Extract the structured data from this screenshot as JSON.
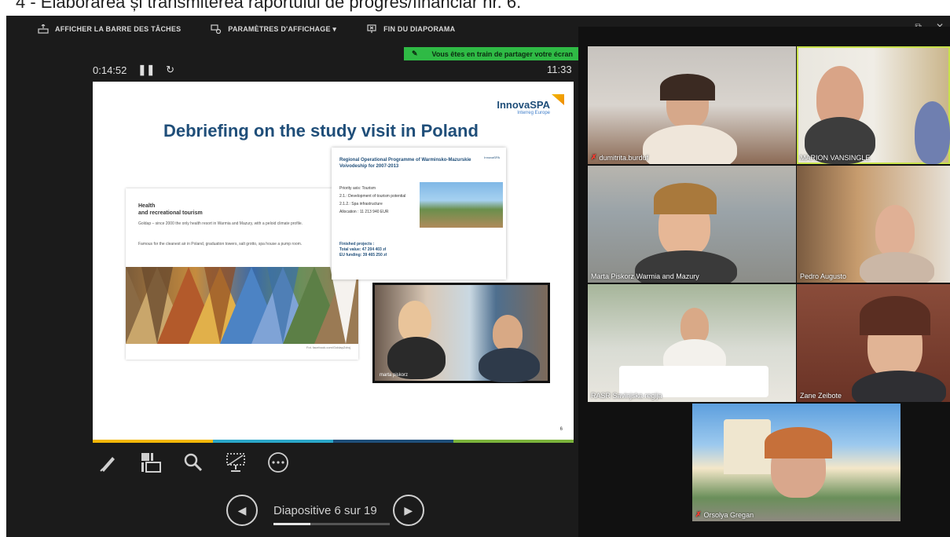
{
  "doc_caption": "4 - Elaborarea și transmiterea raportului de progres/financiar nr. 6.",
  "toolbar": {
    "taskbar_label": "AFFICHER LA BARRE DES TÂCHES",
    "display_settings_label": "PARAMÈTRES D'AFFICHAGE ▾",
    "end_slideshow_label": "FIN DU DIAPORAMA"
  },
  "window": {
    "minimize": "–",
    "restore": "⧉",
    "close": "✕"
  },
  "share_banner": "Vous êtes en train de partager votre écran",
  "timer": "0:14:52",
  "clock": "11:33",
  "slide": {
    "title": "Debriefing on the study visit in Poland",
    "logo_name": "InnovaSPA",
    "logo_sub": "Interreg Europe",
    "left_card": {
      "heading_1": "Health",
      "heading_2": "and recreational tourism",
      "para_1": "Goldap – since 2000 the only health resort in Warmia and Mazury, with a peloid climate profile.",
      "para_2": "Famous for the cleanest air in Poland, graduation towers, salt grotto, spa house a pump room.",
      "photo_credit": "Fot. facebook.com/GoldapZdroj"
    },
    "right_card": {
      "heading": "Regional Operational Programme of Warminsko-Mazurskie Voivodeship for 2007-2013",
      "bullets": [
        "Priority axis: Tourism",
        "2.1.: Development of tourism potential",
        "2.1.2.: Spa infrastructure",
        "Allocation : 11 213 940 EUR"
      ],
      "finished_title": "Finished projects :",
      "finished_items": [
        "Total value: 47 204 403 zł",
        "EU funding: 39 465 250 zł"
      ]
    },
    "video_inset_label": "marta piskorz",
    "page_number": "6"
  },
  "tools": {
    "pen": "pen-icon",
    "grid": "slides-grid-icon",
    "zoom": "zoom-icon",
    "pointer": "screen-pointer-icon",
    "more": "more-options-icon"
  },
  "navigation": {
    "prev": "◀",
    "next": "▶",
    "label": "Diapositive 6 sur 19",
    "progress": 0.316
  },
  "participants": [
    {
      "name": "dumitrita.burduf",
      "muted": true
    },
    {
      "name": "MARION VANSINGLE",
      "muted": false,
      "active": true
    },
    {
      "name": "Marta Piskorz Warmia and Mazury",
      "muted": false
    },
    {
      "name": "Pedro Augusto",
      "muted": false
    },
    {
      "name": "RASR Savinjska regija",
      "muted": false
    },
    {
      "name": "Zane Zeibote",
      "muted": false
    },
    {
      "name": "Orsolya Gregan",
      "muted": true
    }
  ],
  "colors": {
    "share_banner": "#2fba45",
    "active_speaker": "#c8e04a",
    "slide_title": "#1f4e79",
    "muted_mic": "#ff3b30"
  }
}
